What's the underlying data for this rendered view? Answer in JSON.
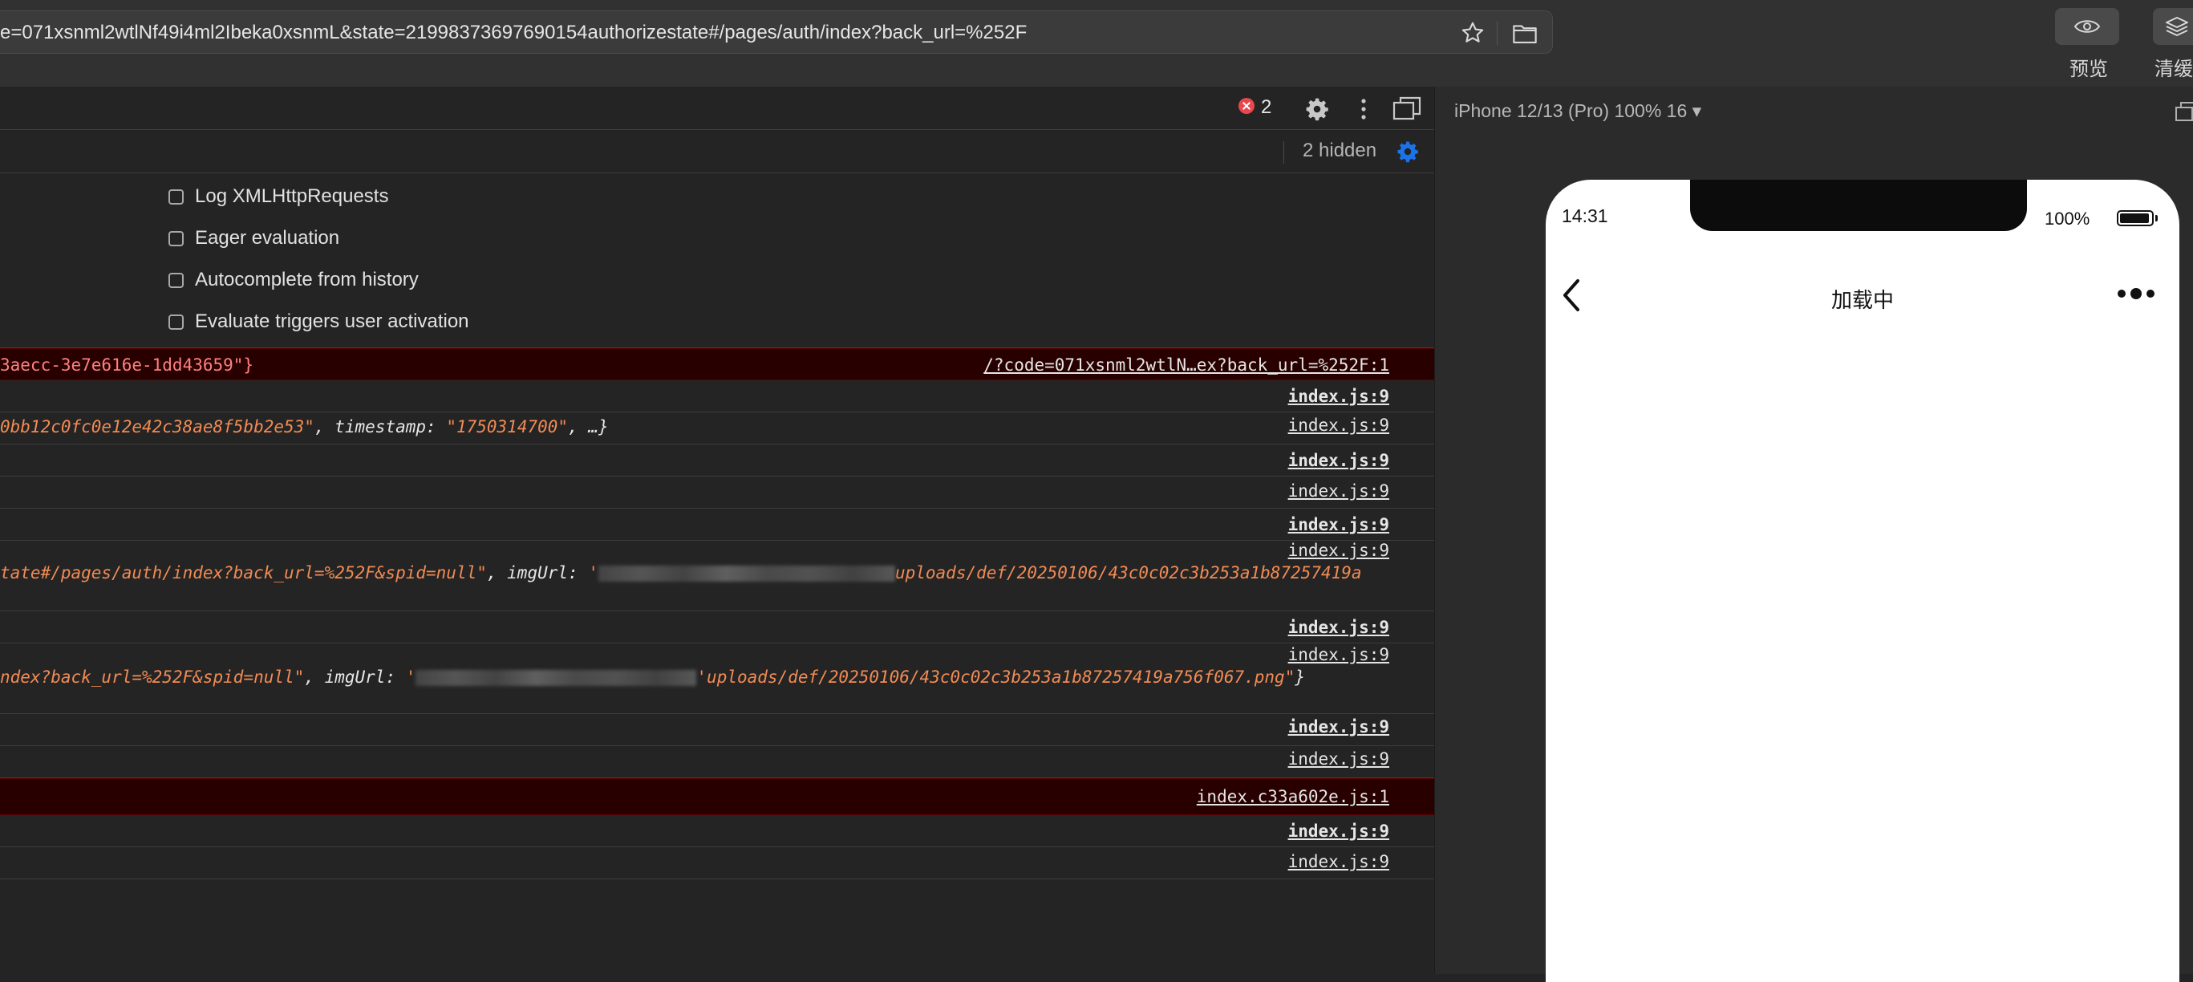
{
  "browser": {
    "url": "e=071xsnml2wtlNf49i4ml2Ibeka0xsnmL&state=21998373697690154authorizestate#/pages/auth/index?back_url=%252F",
    "toolbar_buttons": [
      {
        "label": "预览",
        "icon": "eye-icon"
      },
      {
        "label": "清缓",
        "icon": "layers-icon"
      }
    ]
  },
  "devtools": {
    "error_count": "2",
    "hidden_count": "2 hidden",
    "settings": [
      {
        "label": "Log XMLHttpRequests",
        "checked": false
      },
      {
        "label": "Eager evaluation",
        "checked": false
      },
      {
        "label": "Autocomplete from history",
        "checked": false
      },
      {
        "label": "Evaluate triggers user activation",
        "checked": false
      }
    ],
    "log": [
      {
        "type": "error",
        "text": "3aecc-3e7e616e-1dd43659\"}",
        "source": "/?code=071xsnml2wtlN…ex?back_url=%252F:1"
      },
      {
        "type": "log",
        "text": "",
        "source": "index.js:9"
      },
      {
        "type": "log",
        "text_str": "0bb12c0fc0e12e42c38ae8f5bb2e53\"",
        "text_key": ", timestamp: ",
        "text_str2": "\"1750314700\"",
        "text_tail": ", …}",
        "source": "index.js:9"
      },
      {
        "type": "log",
        "text": "",
        "source": "index.js:9"
      },
      {
        "type": "log",
        "text": "",
        "source": "index.js:9"
      },
      {
        "type": "log",
        "text": "",
        "source": "index.js:9"
      },
      {
        "type": "log",
        "text_str": "tate#/pages/auth/index?back_url=%252F&spid=null\"",
        "text_key": ", imgUrl: ",
        "text_str2": "uploads/def/20250106/43c0c02c3b253a1b87257419a",
        "source": "index.js:9"
      },
      {
        "type": "log",
        "text": "",
        "source": "index.js:9"
      },
      {
        "type": "log",
        "text_str": "ndex?back_url=%252F&spid=null\"",
        "text_key": ", imgUrl: ",
        "text_str2": "uploads/def/20250106/43c0c02c3b253a1b87257419a756f067.png\"",
        "text_tail": "}",
        "source": "index.js:9"
      },
      {
        "type": "log",
        "text": "",
        "source": "index.js:9"
      },
      {
        "type": "log",
        "text": "",
        "source": "index.js:9"
      },
      {
        "type": "error",
        "text": "",
        "source": "index.c33a602e.js:1"
      },
      {
        "type": "log",
        "text": "",
        "source": "index.js:9"
      },
      {
        "type": "log",
        "text": "",
        "source": "index.js:9"
      }
    ]
  },
  "simulator": {
    "device": "iPhone 12/13 (Pro) 100% 16 ▾",
    "status_time": "14:31",
    "battery": "100%",
    "nav_title": "加载中"
  },
  "colors": {
    "error_bg": "#290000",
    "string": "#f28b54",
    "accent": "#1a73e8"
  }
}
